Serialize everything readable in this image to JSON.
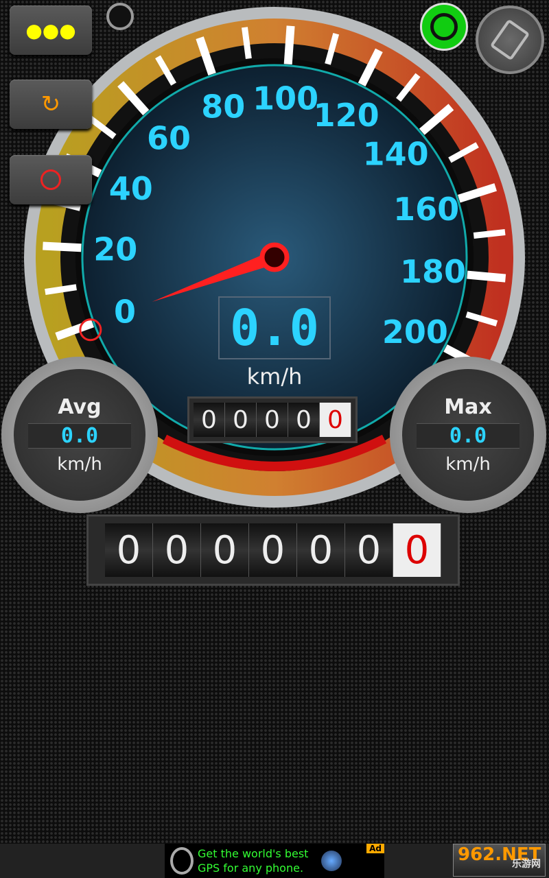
{
  "toolbar": {
    "menu_icon": "more-dots-icon",
    "reset_icon": "refresh-icon",
    "record_icon": "record-circle-icon",
    "gps_icon": "gps-satellite-icon",
    "rotate_icon": "rotate-screen-icon"
  },
  "gauge": {
    "labels": [
      "0",
      "20",
      "40",
      "60",
      "80",
      "100",
      "120",
      "140",
      "160",
      "180",
      "200"
    ],
    "min": 0,
    "max": 200,
    "needle_value": 0,
    "speed": "0.0",
    "unit": "km/h"
  },
  "trip_odometer": [
    "0",
    "0",
    "0",
    "0",
    "0"
  ],
  "avg": {
    "title": "Avg",
    "value": "0.0",
    "unit": "km/h"
  },
  "max": {
    "title": "Max",
    "value": "0.0",
    "unit": "km/h"
  },
  "odometer": [
    "0",
    "0",
    "0",
    "0",
    "0",
    "0",
    "0"
  ],
  "ad": {
    "line1": "Get the world's best",
    "line2": "GPS for any phone.",
    "tag": "Ad"
  },
  "watermark": {
    "main": "962.NET",
    "sub": "乐游网"
  },
  "colors": {
    "accent": "#2cd3ff",
    "needle": "#ff2020",
    "gps": "#11cc11"
  }
}
